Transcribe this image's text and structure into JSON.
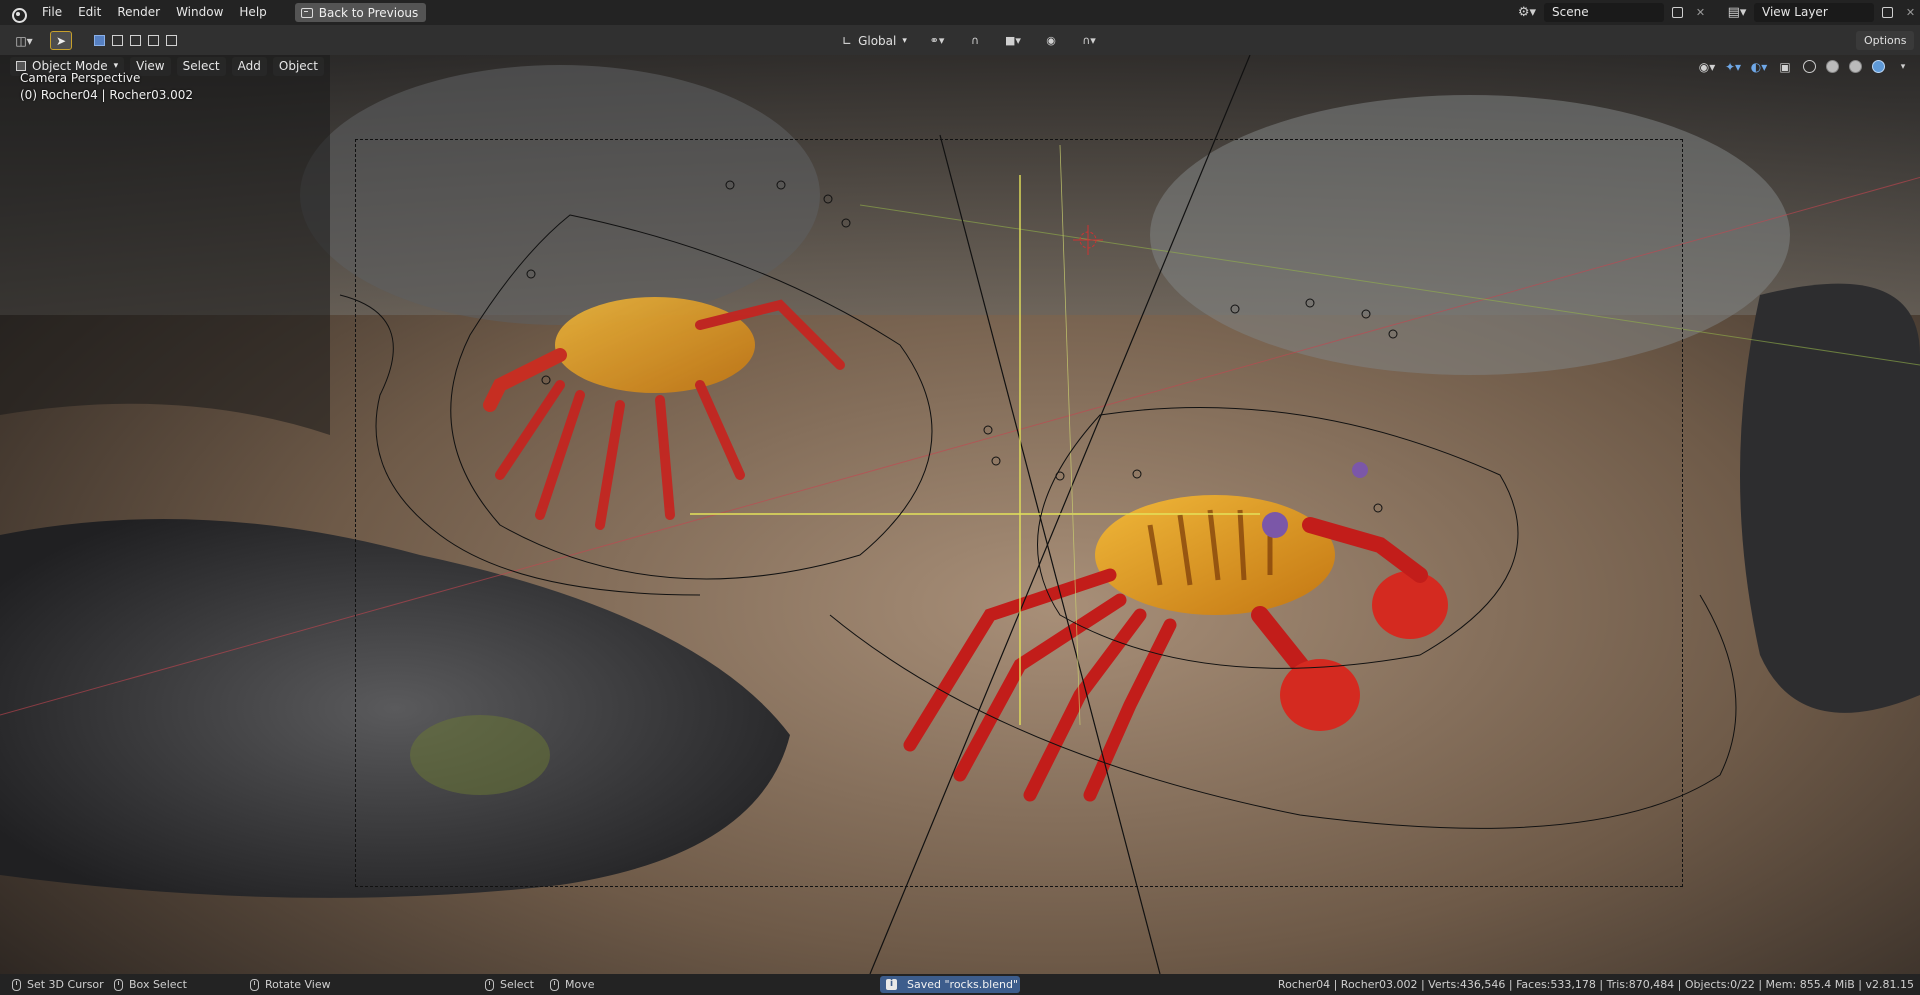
{
  "menu": {
    "file": "File",
    "edit": "Edit",
    "render": "Render",
    "window": "Window",
    "help": "Help",
    "back_button": "Back to Previous"
  },
  "topright": {
    "scene": "Scene",
    "view_layer": "View Layer"
  },
  "header": {
    "transform_orientation": "Global",
    "options": "Options"
  },
  "viewport": {
    "mode": "Object Mode",
    "menus": [
      "View",
      "Select",
      "Add",
      "Object"
    ],
    "perspective": "Camera Perspective",
    "active_object": "(0) Rocher04 | Rocher03.002"
  },
  "status": {
    "set_cursor": "Set 3D Cursor",
    "box_select": "Box Select",
    "rotate_view": "Rotate View",
    "select": "Select",
    "move": "Move",
    "saved_message": "Saved \"rocks.blend\"",
    "stats": "Rocher04 | Rocher03.002 | Verts:436,546 | Faces:533,178 | Tris:870,484 | Objects:0/22 | Mem: 855.4 MiB | v2.81.15"
  },
  "colors": {
    "accent_active": "#c7a02b",
    "selection_blue": "#5680c2",
    "status_info": "#3d5d8c"
  }
}
